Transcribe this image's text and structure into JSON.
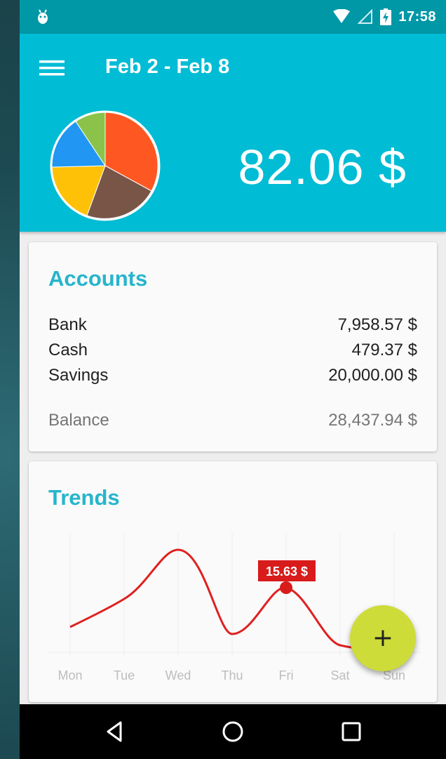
{
  "status_bar": {
    "time": "17:58",
    "icons": [
      "android-debug-icon",
      "wifi-icon",
      "signal-icon",
      "battery-charging-icon"
    ]
  },
  "app_bar": {
    "menu_icon": "menu-icon",
    "title": "Feb 2 - Feb 8",
    "total": "82.06 $",
    "pie_colors": [
      "#ff5722",
      "#795548",
      "#ffc107",
      "#2196f3",
      "#8bc34a"
    ]
  },
  "accounts": {
    "title": "Accounts",
    "items": [
      {
        "name": "Bank",
        "amount": "7,958.57 $"
      },
      {
        "name": "Cash",
        "amount": "479.37 $"
      },
      {
        "name": "Savings",
        "amount": "20,000.00 $"
      }
    ],
    "balance": {
      "name": "Balance",
      "amount": "28,437.94 $"
    }
  },
  "trends": {
    "title": "Trends",
    "days": [
      "Mon",
      "Tue",
      "Wed",
      "Thu",
      "Fri",
      "Sat",
      "Sun"
    ],
    "highlight_label": "15.63 $",
    "line_color": "#e02020"
  },
  "fab": {
    "icon": "plus-icon",
    "label": "+"
  },
  "nav_bar": {
    "icons": [
      "back-icon",
      "home-icon",
      "recents-icon"
    ]
  }
}
